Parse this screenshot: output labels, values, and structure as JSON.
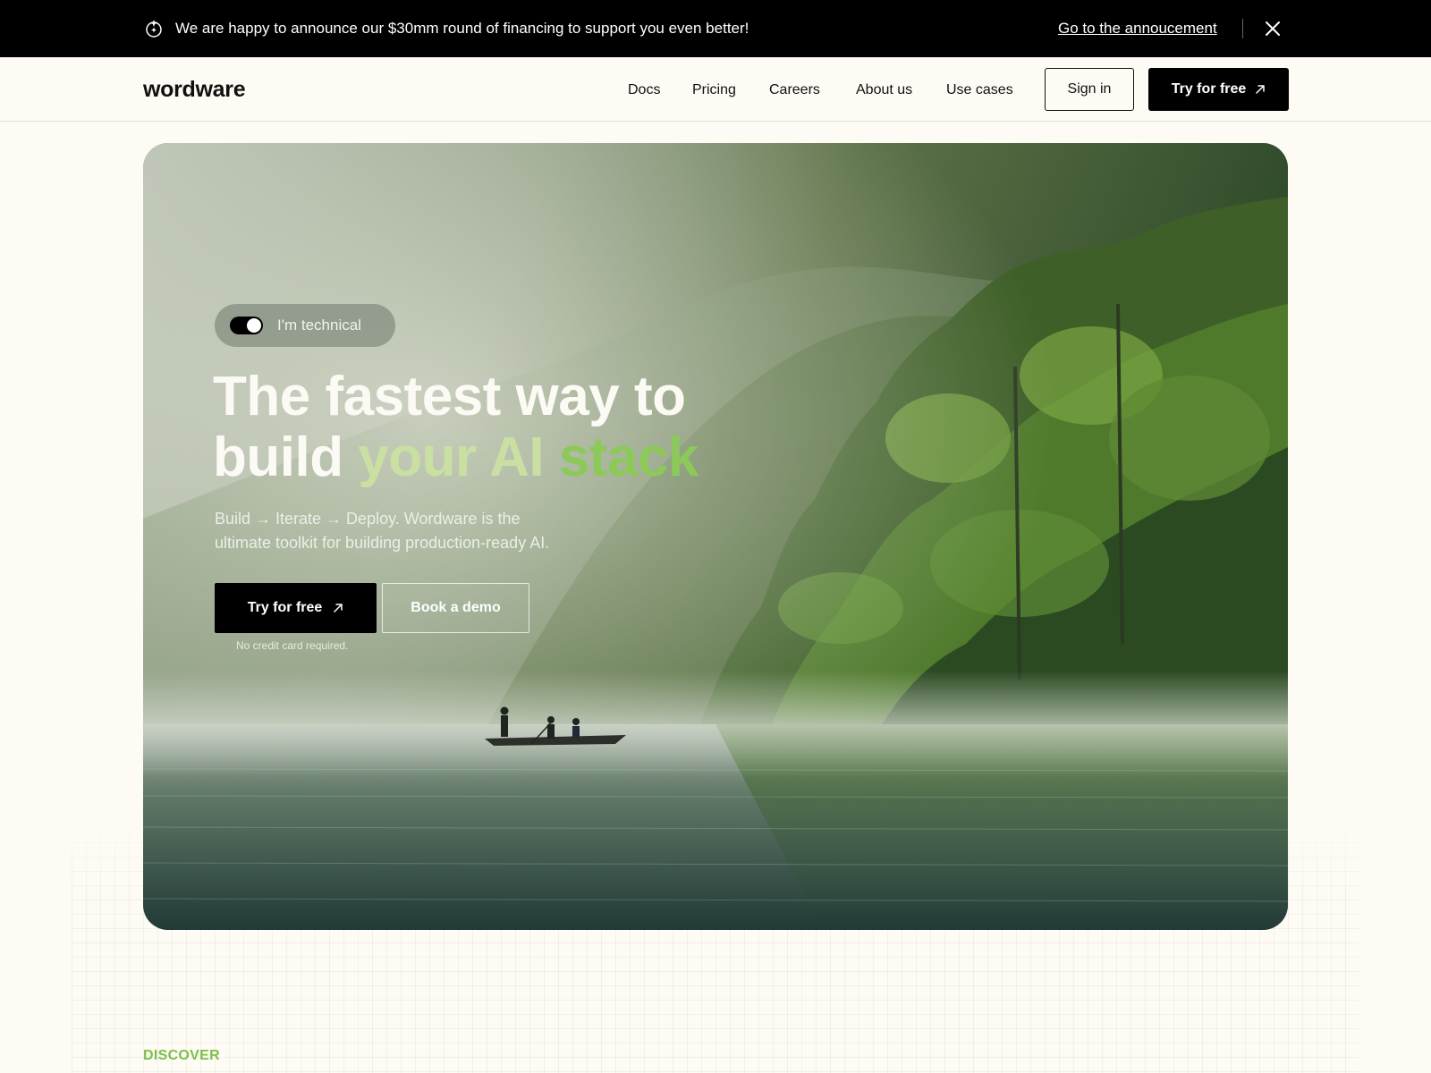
{
  "announcement": {
    "icon": "sparkle-badge-icon",
    "message": "We are happy to announce our $30mm round of financing to support you even better!",
    "link_label": "Go to the annoucement",
    "close_icon": "close-icon"
  },
  "nav": {
    "logo": "wordware",
    "links": [
      "Docs",
      "Pricing",
      "Careers",
      "About us",
      "Use cases"
    ],
    "sign_in_label": "Sign in",
    "try_label": "Try for free",
    "try_icon": "arrow-up-right-icon"
  },
  "hero": {
    "toggle": {
      "label": "I'm technical",
      "on": true
    },
    "headline": {
      "line1": "The fastest way to",
      "line2_plain": "build",
      "line2_accent_1": "your AI",
      "line2_accent_2": "stack"
    },
    "subcopy_line1": "Build → Iterate → Deploy. Wordware is the",
    "subcopy_line2": "ultimate toolkit for building production-ready AI.",
    "primary_cta": "Try for free",
    "secondary_cta": "Book a demo",
    "note": "No credit card required."
  },
  "section": {
    "eyebrow": "DISCOVER"
  },
  "colors": {
    "announcement_bg": "#000000",
    "page_bg": "#fdfbf4",
    "accent_light_green": "#c9e0a2",
    "accent_green": "#8cc95a",
    "eyebrow_green": "#7cbf4a"
  }
}
